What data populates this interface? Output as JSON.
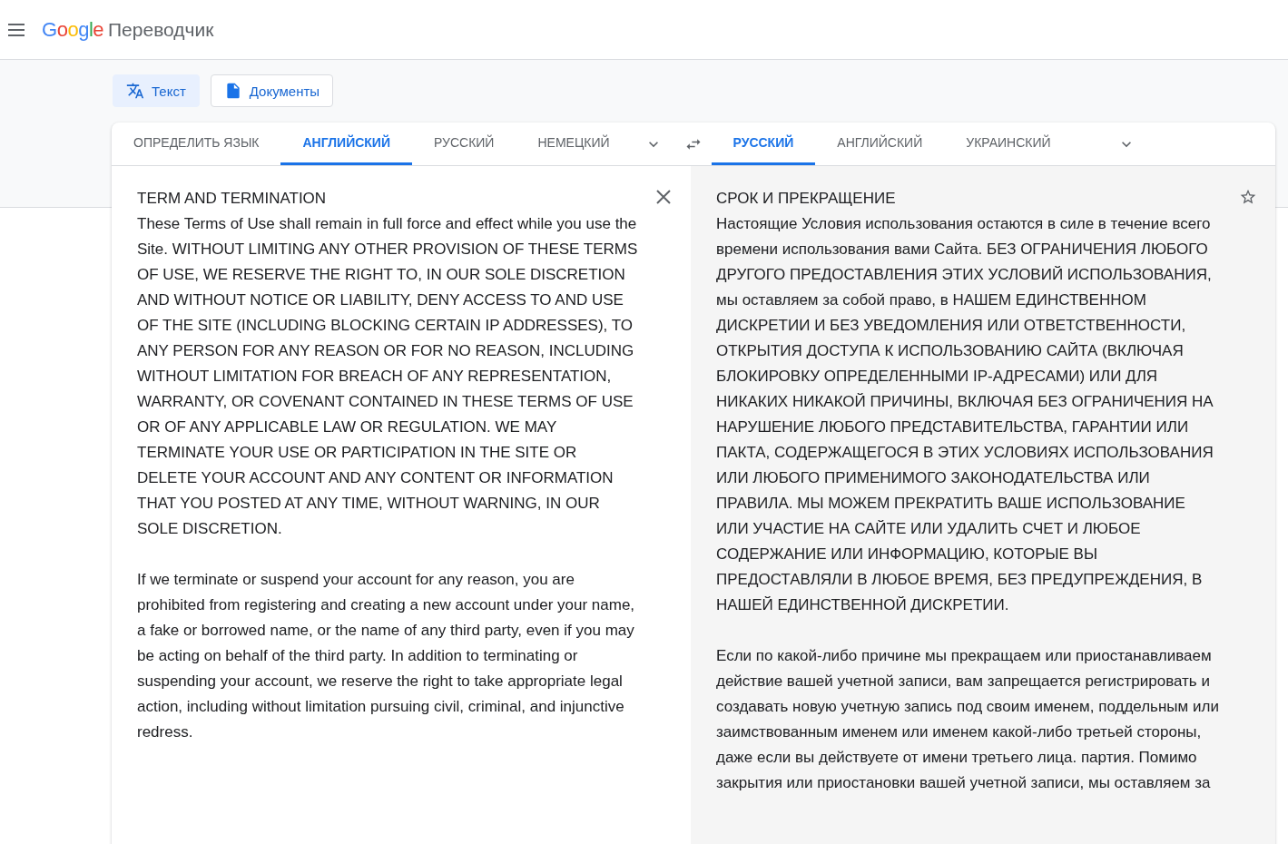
{
  "header": {
    "logo": "Google",
    "app_name": "Переводчик"
  },
  "modes": [
    {
      "label": "Текст",
      "kind": "text",
      "selected": true
    },
    {
      "label": "Документы",
      "kind": "documents",
      "selected": false
    }
  ],
  "source_languages": [
    {
      "label": "ОПРЕДЕЛИТЬ ЯЗЫК",
      "selected": false
    },
    {
      "label": "АНГЛИЙСКИЙ",
      "selected": true
    },
    {
      "label": "РУССКИЙ",
      "selected": false
    },
    {
      "label": "НЕМЕЦКИЙ",
      "selected": false
    }
  ],
  "target_languages": [
    {
      "label": "РУССКИЙ",
      "selected": true
    },
    {
      "label": "АНГЛИЙСКИЙ",
      "selected": false
    },
    {
      "label": "УКРАИНСКИЙ",
      "selected": false
    }
  ],
  "source": {
    "title": "TERM AND TERMINATION",
    "paragraphs": [
      "These Terms of Use shall remain in full force and effect while you use the Site. WITHOUT LIMITING ANY OTHER PROVISION OF THESE TERMS OF USE, WE RESERVE THE RIGHT TO, IN OUR SOLE DISCRETION AND WITHOUT NOTICE OR LIABILITY, DENY ACCESS TO AND USE OF THE SITE (INCLUDING BLOCKING CERTAIN IP ADDRESSES), TO ANY PERSON FOR ANY REASON OR FOR NO REASON, INCLUDING WITHOUT LIMITATION FOR BREACH OF ANY REPRESENTATION, WARRANTY, OR COVENANT CONTAINED IN THESE TERMS OF USE OR OF ANY APPLICABLE LAW OR REGULATION. WE MAY TERMINATE YOUR USE OR PARTICIPATION IN THE SITE OR DELETE YOUR ACCOUNT AND ANY CONTENT OR INFORMATION THAT YOU POSTED AT ANY TIME, WITHOUT WARNING, IN OUR SOLE DISCRETION.",
      "If we terminate or suspend your account for any reason, you are prohibited from registering and creating a new account under your name, a fake or borrowed name, or the name of any third party, even if you may be acting on behalf of the third party. In addition to terminating or suspending your account, we reserve the right to take appropriate legal action, including without limitation pursuing civil, criminal, and injunctive redress."
    ]
  },
  "translation": {
    "title": "СРОК И ПРЕКРАЩЕНИЕ",
    "paragraphs": [
      "Настоящие Условия использования остаются в силе в течение всего времени использования вами Сайта. БЕЗ ОГРАНИЧЕНИЯ ЛЮБОГО ДРУГОГО ПРЕДОСТАВЛЕНИЯ ЭТИХ УСЛОВИЙ ИСПОЛЬЗОВАНИЯ, мы оставляем за собой право, в НАШЕМ ЕДИНСТВЕННОМ ДИСКРЕТИИ И БЕЗ УВЕДОМЛЕНИЯ ИЛИ ОТВЕТСТВЕННОСТИ, ОТКРЫТИЯ ДОСТУПА К ИСПОЛЬЗОВАНИЮ САЙТА (ВКЛЮЧАЯ БЛОКИРОВКУ ОПРЕДЕЛЕННЫМИ IP-АДРЕСАМИ) ИЛИ ДЛЯ НИКАКИХ НИКАКОЙ ПРИЧИНЫ, ВКЛЮЧАЯ БЕЗ ОГРАНИЧЕНИЯ НА НАРУШЕНИЕ ЛЮБОГО ПРЕДСТАВИТЕЛЬСТВА, ГАРАНТИИ ИЛИ ПАКТА, СОДЕРЖАЩЕГОСЯ В ЭТИХ УСЛОВИЯХ ИСПОЛЬЗОВАНИЯ ИЛИ ЛЮБОГО ПРИМЕНИМОГО ЗАКОНОДАТЕЛЬСТВА ИЛИ ПРАВИЛА. МЫ МОЖЕМ ПРЕКРАТИТЬ ВАШЕ ИСПОЛЬЗОВАНИЕ ИЛИ УЧАСТИЕ НА САЙТЕ ИЛИ УДАЛИТЬ СЧЕТ И ЛЮБОЕ СОДЕРЖАНИЕ ИЛИ ИНФОРМАЦИЮ, КОТОРЫЕ ВЫ ПРЕДОСТАВЛЯЛИ В ЛЮБОЕ ВРЕМЯ, БЕЗ ПРЕДУПРЕЖДЕНИЯ, В НАШЕЙ ЕДИНСТВЕННОЙ ДИСКРЕТИИ.",
      "Если по какой-либо причине мы прекращаем или приостанавливаем действие вашей учетной записи, вам запрещается регистрировать и создавать новую учетную запись под своим именем, поддельным или заимствованным именем или именем какой-либо третьей стороны, даже если вы действуете от имени третьего лица. партия. Помимо закрытия или приостановки вашей учетной записи, мы оставляем за"
    ]
  }
}
